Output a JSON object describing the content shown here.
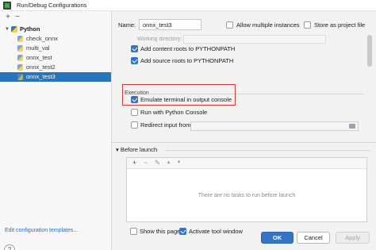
{
  "window": {
    "title": "Run/Debug Configurations"
  },
  "tree_toolbar": {
    "add": "+",
    "remove": "−"
  },
  "tree": {
    "root": {
      "label": "Python"
    },
    "items": [
      {
        "label": "check_onnx"
      },
      {
        "label": "multi_val"
      },
      {
        "label": "onnx_test"
      },
      {
        "label": "onnx_test2"
      },
      {
        "label": "onnx_test3"
      }
    ],
    "selected": "onnx_test3"
  },
  "edit_templates": "Edit configuration templates...",
  "help": "?",
  "config": {
    "name_label": "Name:",
    "name_value": "onnx_test3",
    "allow_multiple": {
      "label": "Allow multiple instances",
      "checked": false
    },
    "store_as_project": {
      "label": "Store as project file",
      "checked": false
    },
    "content_roots": {
      "label": "Add content roots to PYTHONPATH",
      "checked": true
    },
    "source_roots": {
      "label": "Add source roots to PYTHONPATH",
      "checked": true
    },
    "execution_header": "Execution",
    "emulate_terminal": {
      "label": "Emulate terminal in output console",
      "checked": true
    },
    "python_console": {
      "label": "Run with Python Console",
      "checked": false
    },
    "redirect_input": {
      "label": "Redirect input from:",
      "checked": false
    }
  },
  "before_launch": {
    "header": "Before launch",
    "toolbar": {
      "add": "+",
      "remove": "−",
      "edit": "✎",
      "up": "▲",
      "down": "▼"
    },
    "empty_text": "There are no tasks to run before launch",
    "show_page": {
      "label": "Show this page",
      "checked": false
    },
    "activate_tool_window": {
      "label": "Activate tool window",
      "checked": true
    }
  },
  "buttons": {
    "ok": "OK",
    "cancel": "Cancel",
    "apply": "Apply"
  },
  "colors": {
    "selection": "#2675bf",
    "accent": "#3574c5",
    "highlight_box": "#d63a3a"
  }
}
